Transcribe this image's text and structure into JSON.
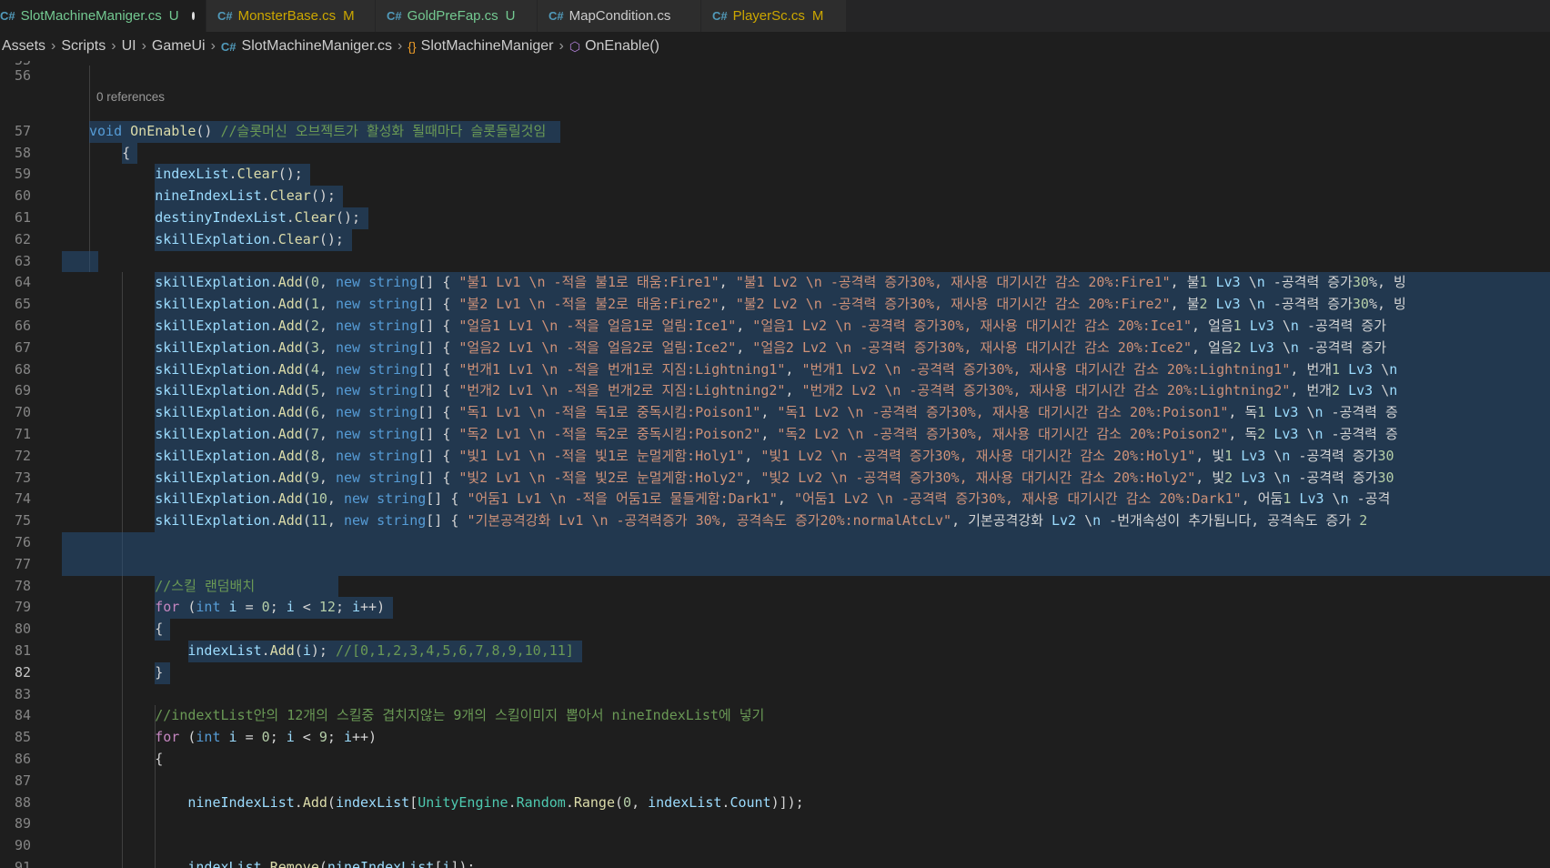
{
  "tabs": [
    {
      "label": "SlotMachineManiger.cs",
      "status": "U",
      "active": true,
      "dirty": true
    },
    {
      "label": "MonsterBase.cs",
      "status": "M"
    },
    {
      "label": "GoldPreFap.cs",
      "status": "U"
    },
    {
      "label": "MapCondition.cs",
      "status": ""
    },
    {
      "label": "PlayerSc.cs",
      "status": "M"
    }
  ],
  "breadcrumb": [
    "Assets",
    "Scripts",
    "UI",
    "GameUi",
    "SlotMachineManiger.cs",
    "SlotMachineManiger",
    "OnEnable()"
  ],
  "editor": {
    "top_partial_line": "55",
    "codelens": "0 references",
    "current_line": "82",
    "lines": [
      {
        "n": "56",
        "code": ""
      },
      {
        "n": "57",
        "code": "void OnEnable() //슬롯머신 오브젝트가 활성화 될때마다 슬롯돌릴것임"
      },
      {
        "n": "58",
        "code": "    {"
      },
      {
        "n": "59",
        "code": "        indexList.Clear();"
      },
      {
        "n": "60",
        "code": "        nineIndexList.Clear();"
      },
      {
        "n": "61",
        "code": "        destinyIndexList.Clear();"
      },
      {
        "n": "62",
        "code": "        skillExplation.Clear();"
      },
      {
        "n": "63",
        "code": ""
      },
      {
        "n": "64",
        "code": "        skillExplation.Add(0, new string[] { \"불1 Lv1 \\n -적을 불1로 태움:Fire1\", \"불1 Lv2 \\n -공격력 증가30%, 재사용 대기시간 감소 20%:Fire1\", \"불1 Lv3 \\n -공격력 증가30%, 빙"
      },
      {
        "n": "65",
        "code": "        skillExplation.Add(1, new string[] { \"불2 Lv1 \\n -적을 불2로 태움:Fire2\", \"불2 Lv2 \\n -공격력 증가30%, 재사용 대기시간 감소 20%:Fire2\", \"불2 Lv3 \\n -공격력 증가30%, 빙"
      },
      {
        "n": "66",
        "code": "        skillExplation.Add(2, new string[] { \"얼음1 Lv1 \\n -적을 얼음1로 얼림:Ice1\", \"얼음1 Lv2 \\n -공격력 증가30%, 재사용 대기시간 감소 20%:Ice1\", \"얼음1 Lv3 \\n -공격력 증가"
      },
      {
        "n": "67",
        "code": "        skillExplation.Add(3, new string[] { \"얼음2 Lv1 \\n -적을 얼음2로 얼림:Ice2\", \"얼음2 Lv2 \\n -공격력 증가30%, 재사용 대기시간 감소 20%:Ice2\", \"얼음2 Lv3 \\n -공격력 증가"
      },
      {
        "n": "68",
        "code": "        skillExplation.Add(4, new string[] { \"번개1 Lv1 \\n -적을 번개1로 지짐:Lightning1\", \"번개1 Lv2 \\n -공격력 증가30%, 재사용 대기시간 감소 20%:Lightning1\", \"번개1 Lv3 \\n"
      },
      {
        "n": "69",
        "code": "        skillExplation.Add(5, new string[] { \"번개2 Lv1 \\n -적을 번개2로 지짐:Lightning2\", \"번개2 Lv2 \\n -공격력 증가30%, 재사용 대기시간 감소 20%:Lightning2\", \"번개2 Lv3 \\n"
      },
      {
        "n": "70",
        "code": "        skillExplation.Add(6, new string[] { \"독1 Lv1 \\n -적을 독1로 중독시킴:Poison1\", \"독1 Lv2 \\n -공격력 증가30%, 재사용 대기시간 감소 20%:Poison1\", \"독1 Lv3 \\n -공격력 증"
      },
      {
        "n": "71",
        "code": "        skillExplation.Add(7, new string[] { \"독2 Lv1 \\n -적을 독2로 중독시킴:Poison2\", \"독2 Lv2 \\n -공격력 증가30%, 재사용 대기시간 감소 20%:Poison2\", \"독2 Lv3 \\n -공격력 증"
      },
      {
        "n": "72",
        "code": "        skillExplation.Add(8, new string[] { \"빛1 Lv1 \\n -적을 빛1로 눈멀게함:Holy1\", \"빛1 Lv2 \\n -공격력 증가30%, 재사용 대기시간 감소 20%:Holy1\", \"빛1 Lv3 \\n -공격력 증가30"
      },
      {
        "n": "73",
        "code": "        skillExplation.Add(9, new string[] { \"빛2 Lv1 \\n -적을 빛2로 눈멀게함:Holy2\", \"빛2 Lv2 \\n -공격력 증가30%, 재사용 대기시간 감소 20%:Holy2\", \"빛2 Lv3 \\n -공격력 증가30"
      },
      {
        "n": "74",
        "code": "        skillExplation.Add(10, new string[] { \"어둠1 Lv1 \\n -적을 어둠1로 물들게함:Dark1\", \"어둠1 Lv2 \\n -공격력 증가30%, 재사용 대기시간 감소 20%:Dark1\", \"어둠1 Lv3 \\n -공격"
      },
      {
        "n": "75",
        "code": "        skillExplation.Add(11, new string[] { \"기본공격강화 Lv1 \\n -공격력증가 30%, 공격속도 증가20%:normalAtcLv\", \"기본공격강화 Lv2 \\n -번개속성이 추가됩니다, 공격속도 증가 2"
      },
      {
        "n": "76",
        "code": ""
      },
      {
        "n": "77",
        "code": ""
      },
      {
        "n": "78",
        "code": "        //스킬 랜덤배치"
      },
      {
        "n": "79",
        "code": "        for (int i = 0; i < 12; i++)"
      },
      {
        "n": "80",
        "code": "        {"
      },
      {
        "n": "81",
        "code": "            indexList.Add(i); //[0,1,2,3,4,5,6,7,8,9,10,11]"
      },
      {
        "n": "82",
        "code": "        }"
      },
      {
        "n": "83",
        "code": ""
      },
      {
        "n": "84",
        "code": "        //indextList안의 12개의 스킬중 겹치지않는 9개의 스킬이미지 뽑아서 nineIndexList에 넣기"
      },
      {
        "n": "85",
        "code": "        for (int i = 0; i < 9; i++)"
      },
      {
        "n": "86",
        "code": "        {"
      },
      {
        "n": "87",
        "code": ""
      },
      {
        "n": "88",
        "code": "            nineIndexList.Add(indexList[UnityEngine.Random.Range(0, indexList.Count)]);"
      },
      {
        "n": "89",
        "code": ""
      },
      {
        "n": "90",
        "code": ""
      },
      {
        "n": "91",
        "code": "            indexList.Remove(nineIndexList[i]);"
      }
    ]
  },
  "colors": {
    "keyword": "#569cd6",
    "control": "#c586c0",
    "function": "#dcdcaa",
    "variable": "#9cdcfe",
    "number": "#b5cea8",
    "string": "#ce9178",
    "comment": "#6a9955",
    "type": "#4ec9b0",
    "selection": "#264f78",
    "modified": "#cca700",
    "untracked": "#73c991"
  }
}
